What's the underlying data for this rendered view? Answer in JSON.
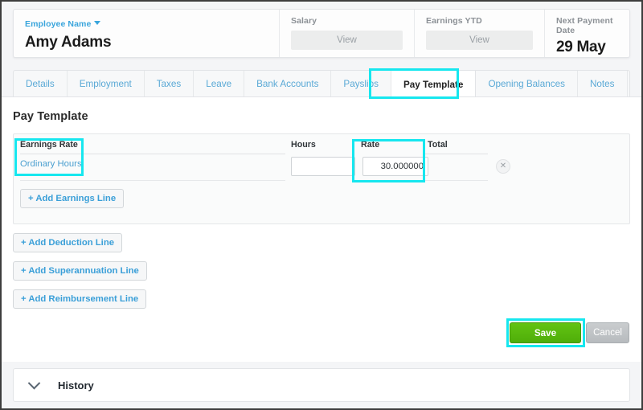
{
  "header": {
    "employee_label": "Employee Name",
    "employee_name": "Amy Adams",
    "salary_label": "Salary",
    "salary_value": "View",
    "earnings_ytd_label": "Earnings YTD",
    "earnings_ytd_value": "View",
    "next_payment_label": "Next Payment Date",
    "next_payment_value": "29 May"
  },
  "tabs": [
    {
      "label": "Details",
      "active": false
    },
    {
      "label": "Employment",
      "active": false
    },
    {
      "label": "Taxes",
      "active": false
    },
    {
      "label": "Leave",
      "active": false
    },
    {
      "label": "Bank Accounts",
      "active": false
    },
    {
      "label": "Payslips",
      "active": false
    },
    {
      "label": "Pay Template",
      "active": true
    },
    {
      "label": "Opening Balances",
      "active": false
    },
    {
      "label": "Notes",
      "active": false
    }
  ],
  "main": {
    "title": "Pay Template",
    "earnings_table": {
      "columns": [
        "Earnings Rate",
        "Hours",
        "Rate",
        "Total"
      ],
      "rows": [
        {
          "earnings_rate": "Ordinary Hours",
          "hours": "",
          "rate": "30.000000",
          "total": "",
          "delete_icon": "close-icon"
        }
      ]
    },
    "buttons": {
      "add_earnings": "+ Add Earnings Line",
      "add_deduction": "+ Add Deduction Line",
      "add_superannuation": "+ Add Superannuation Line",
      "add_reimbursement": "+ Add Reimbursement Line",
      "save": "Save",
      "cancel": "Cancel"
    }
  },
  "history": {
    "label": "History",
    "chevron_icon": "chevron-down-icon"
  },
  "colors": {
    "highlight": "#16e7ef",
    "link": "#3aa5dc",
    "save_green": "#53b30b"
  }
}
